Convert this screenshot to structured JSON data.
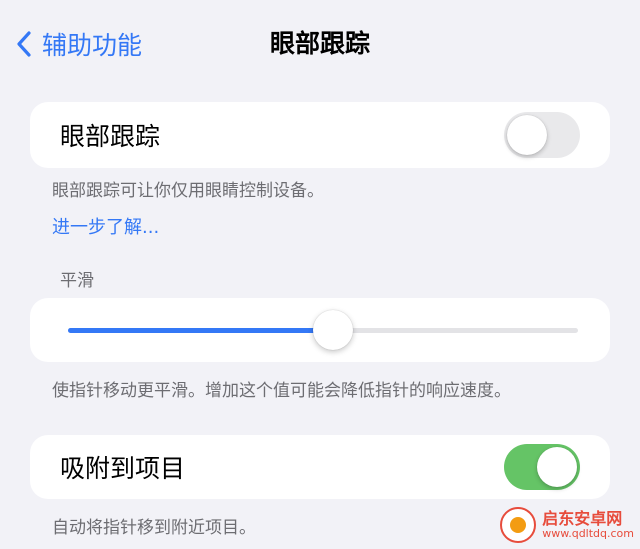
{
  "nav": {
    "back_label": "辅助功能",
    "title": "眼部跟踪",
    "back_icon": "chevron-left-icon"
  },
  "eye_tracking": {
    "label": "眼部跟踪",
    "toggle_on": false,
    "footnote": "眼部跟踪可让你仅用眼睛控制设备。",
    "learn_more": "进一步了解..."
  },
  "smoothing": {
    "header": "平滑",
    "value_fraction": 0.52,
    "footnote": "使指针移动更平滑。增加这个值可能会降低指针的响应速度。"
  },
  "snap_to_item": {
    "label": "吸附到项目",
    "toggle_on": true,
    "footnote": "自动将指针移到附近项目。"
  },
  "watermark": {
    "name": "启东安卓网",
    "url": "www.qdltdq.com"
  },
  "colors": {
    "accent": "#3478f6",
    "toggle_on": "#65c466",
    "toggle_off": "#e9e9eb",
    "background": "#f2f2f7",
    "secondary_text": "#6d6d72"
  }
}
